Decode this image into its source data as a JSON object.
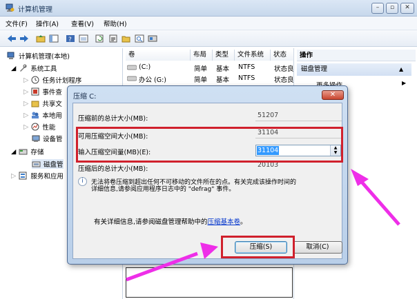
{
  "window": {
    "title": "计算机管理",
    "min": "–",
    "max": "▫",
    "close": "✕"
  },
  "menu": [
    "文件(F)",
    "操作(A)",
    "查看(V)",
    "帮助(H)"
  ],
  "tree": {
    "root": "计算机管理(本地)",
    "system_tools": "系统工具",
    "task_scheduler": "任务计划程序",
    "event_viewer": "事件查",
    "shared_folders": "共享文",
    "local_users": "本地用",
    "performance": "性能",
    "device_manager": "设备管",
    "storage": "存储",
    "disk_mgmt": "磁盘管",
    "services": "服务和应用"
  },
  "list": {
    "headers": [
      "卷",
      "布局",
      "类型",
      "文件系统",
      "状态"
    ],
    "rows": [
      [
        "(C:)",
        "简单",
        "基本",
        "NTFS",
        "状态良"
      ],
      [
        "办公 (G:)",
        "简单",
        "基本",
        "NTFS",
        "状态良"
      ]
    ]
  },
  "actions": {
    "header": "操作",
    "selected": "磁盘管理",
    "more": "更多操作"
  },
  "dialog": {
    "title": "压缩 C:",
    "total_before_label": "压缩前的总计大小(MB):",
    "total_before_value": "51207",
    "available_label": "可用压缩空间大小(MB):",
    "available_value": "31104",
    "input_label": "输入压缩空间量(MB)(E):",
    "input_value": "31104",
    "total_after_label": "压缩后的总计大小(MB):",
    "total_after_value": "20103",
    "info_text_1": "无法将卷压缩到超出任何不可移动的文件所在的点。有关完成该操作时间的",
    "info_text_2": "详细信息,请参阅应用程序日志中的 \"defrag\" 事件。",
    "help_prefix": "有关详细信息,请参阅磁盘管理帮助中的",
    "help_link": "压缩基本卷",
    "help_suffix": "。",
    "shrink_button": "压缩(S)",
    "cancel_button": "取消(C)"
  },
  "colors": {
    "highlight": "#d0202c",
    "arrow": "#ee2ee8"
  }
}
